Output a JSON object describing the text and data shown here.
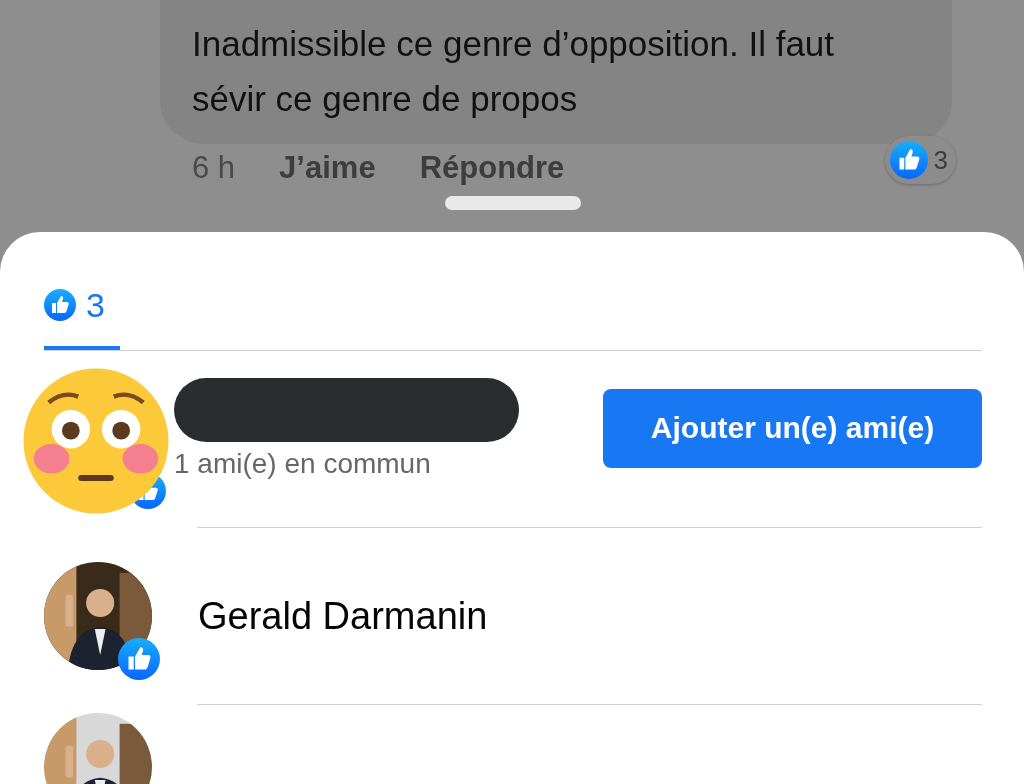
{
  "comment": {
    "text": "Inadmissible ce genre d’opposition. Il faut sévir ce genre de propos",
    "time": "6 h",
    "actions": [
      "J’aime",
      "Répondre"
    ],
    "reaction_count": "3"
  },
  "tab": {
    "count": "3",
    "selected": true
  },
  "people": [
    {
      "kind": "suggestion",
      "mutual": "1 ami(e) en commun",
      "button": "Ajouter un(e) ami(e)"
    },
    {
      "kind": "named",
      "name": "Gerald Darmanin"
    },
    {
      "kind": "cut"
    }
  ]
}
